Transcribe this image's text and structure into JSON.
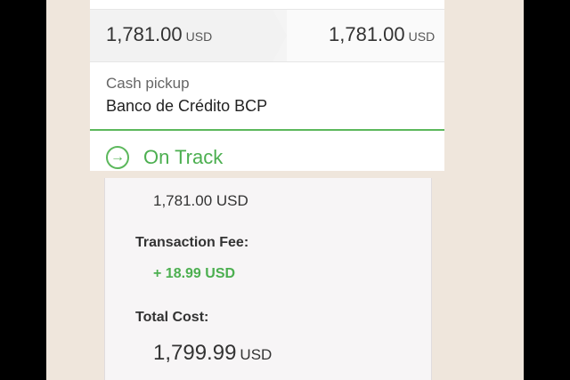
{
  "transfer": {
    "send_amount": "1,781.00",
    "send_currency": "USD",
    "receive_amount": "1,781.00",
    "receive_currency": "USD"
  },
  "delivery": {
    "method": "Cash pickup",
    "bank": "Banco de Crédito BCP"
  },
  "status": {
    "label": "On Track",
    "icon": "arrow-circle-icon",
    "color": "#4caf50"
  },
  "receipt": {
    "amount": "1,781.00 USD",
    "fee_label": "Transaction Fee:",
    "fee_value": "+ 18.99 USD",
    "total_label": "Total Cost:",
    "total_amount": "1,799.99",
    "total_currency": "USD"
  }
}
